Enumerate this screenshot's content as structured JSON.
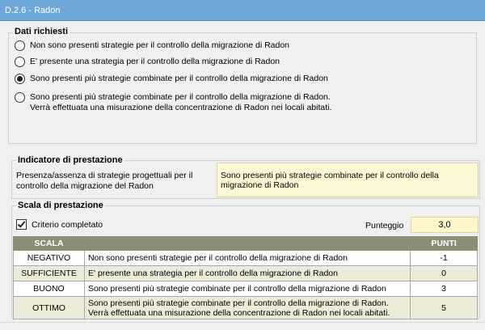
{
  "window": {
    "title": "D.2.6 - Radon"
  },
  "dati_richiesti": {
    "title": "Dati richiesti",
    "options": [
      {
        "label": "Non sono presenti strategie per il controllo della migrazione di Radon",
        "checked": false
      },
      {
        "label": "E' presente una strategia per il controllo della migrazione di Radon",
        "checked": false
      },
      {
        "label": "Sono presenti più strategie combinate per il controllo della migrazione di Radon",
        "checked": true
      },
      {
        "label": "Sono presenti più strategie combinate per il controllo della migrazione di Radon.\nVerrà effettuata una misurazione della concentrazione di Radon nei locali abitati.",
        "checked": false
      }
    ]
  },
  "indicatore": {
    "title": "Indicatore di prestazione",
    "label": "Presenza/assenza di strategie progettuali per il controllo della migrazione del Radon",
    "value": "Sono presenti più strategie combinate per il controllo della migrazione di Radon"
  },
  "scala": {
    "title": "Scala di prestazione",
    "criterio_label": "Criterio completato",
    "criterio_checked": true,
    "punteggio_label": "Punteggio",
    "punteggio_value": "3,0",
    "table": {
      "headers": {
        "scala": "SCALA",
        "punti": "PUNTI"
      },
      "rows": [
        {
          "scala": "NEGATIVO",
          "desc": "Non sono presenti strategie per il controllo della migrazione di Radon",
          "punti": "-1"
        },
        {
          "scala": "SUFFICIENTE",
          "desc": "E' presente una strategia per il controllo della migrazione di Radon",
          "punti": "0"
        },
        {
          "scala": "BUONO",
          "desc": "Sono presenti più strategie combinate per il controllo della migrazione di Radon",
          "punti": "3"
        },
        {
          "scala": "OTTIMO",
          "desc": "Sono presenti più strategie combinate per il controllo della migrazione di Radon.\nVerrà effettuata una misurazione della concentrazione di Radon nei locali abitati.",
          "punti": "5"
        }
      ]
    }
  },
  "colors": {
    "titlebar": "#6fa8d8",
    "table_header": "#8b8f77",
    "highlight_box": "#fdf9d6"
  }
}
